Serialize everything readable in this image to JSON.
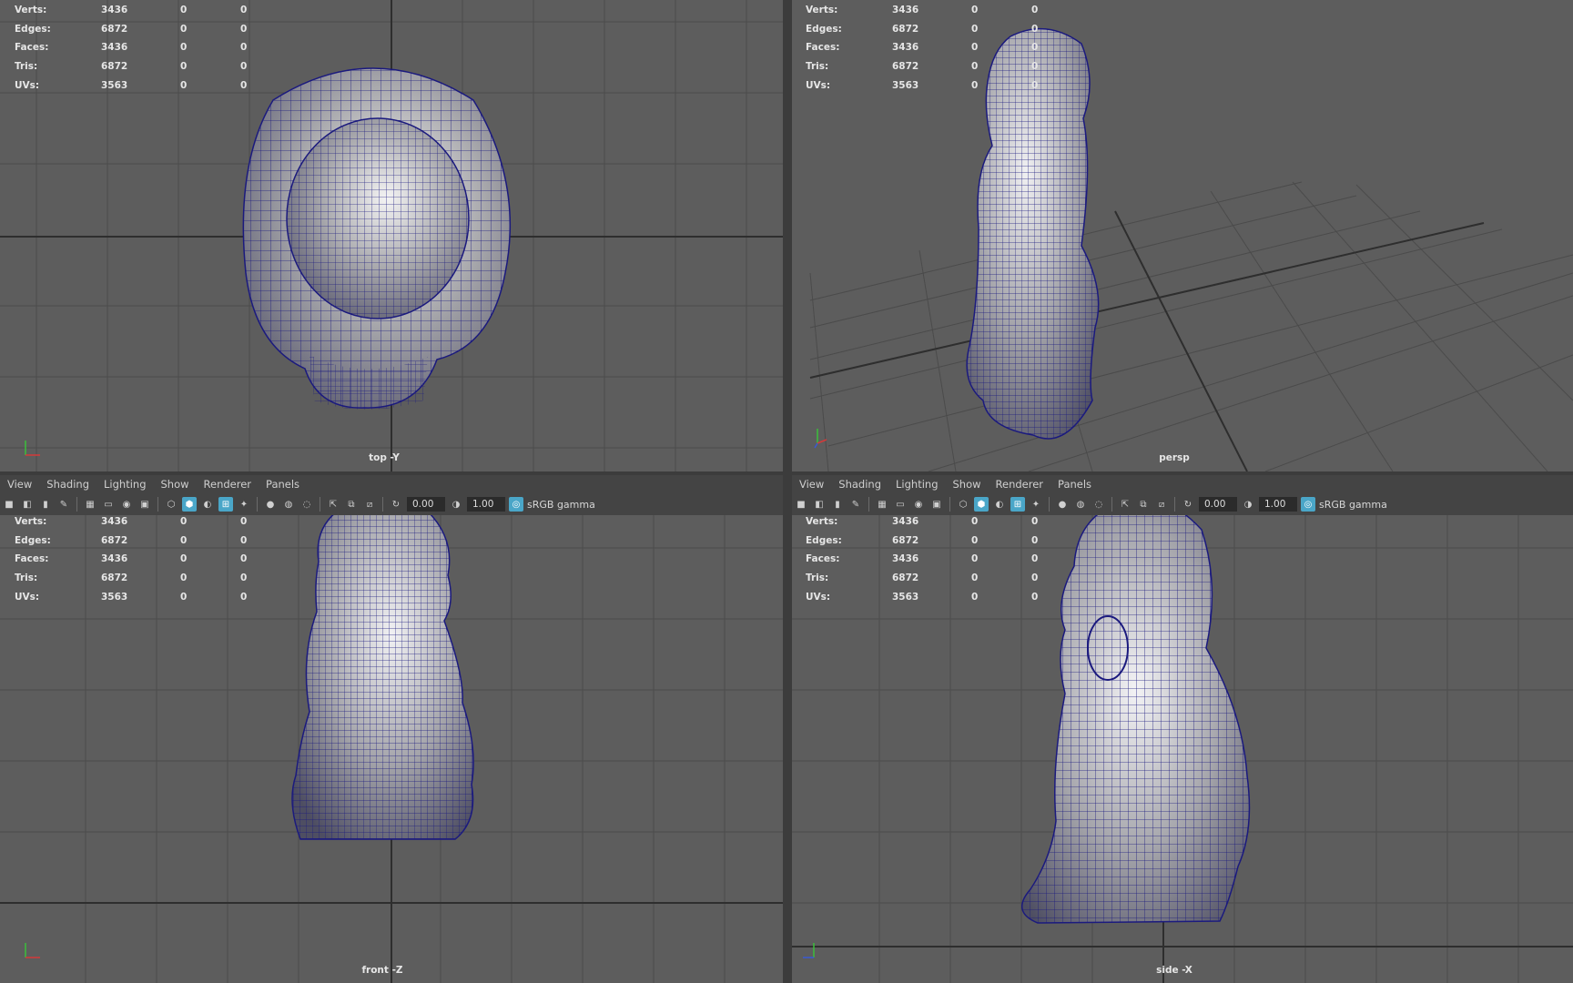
{
  "stats_labels": [
    "Verts:",
    "Edges:",
    "Faces:",
    "Tris:",
    "UVs:"
  ],
  "stats_rows": [
    [
      "3436",
      "0",
      "0"
    ],
    [
      "6872",
      "0",
      "0"
    ],
    [
      "3436",
      "0",
      "0"
    ],
    [
      "6872",
      "0",
      "0"
    ],
    [
      "3563",
      "0",
      "0"
    ]
  ],
  "viewports": {
    "top": {
      "camera": "top -Y"
    },
    "persp": {
      "camera": "persp"
    },
    "front": {
      "camera": "front -Z"
    },
    "side": {
      "camera": "side -X"
    }
  },
  "panel_menu": [
    "View",
    "Shading",
    "Lighting",
    "Show",
    "Renderer",
    "Panels"
  ],
  "toolbar": {
    "exposure": "0.00",
    "gamma": "1.00",
    "color_space": "sRGB gamma"
  },
  "icons": [
    "camera-icon",
    "grid-icon",
    "wireframe-icon",
    "smooth-shade-icon",
    "light-icon",
    "xray-icon",
    "isolate-icon",
    "exposure-icon",
    "gamma-icon",
    "color-management-icon"
  ],
  "colors": {
    "viewport_bg": "#5d5d5d",
    "wire": "#1b1a7e",
    "grid_line": "#4b4b4b",
    "grid_axis": "#2e2e2e",
    "active_icon": "#4aa6c8"
  }
}
